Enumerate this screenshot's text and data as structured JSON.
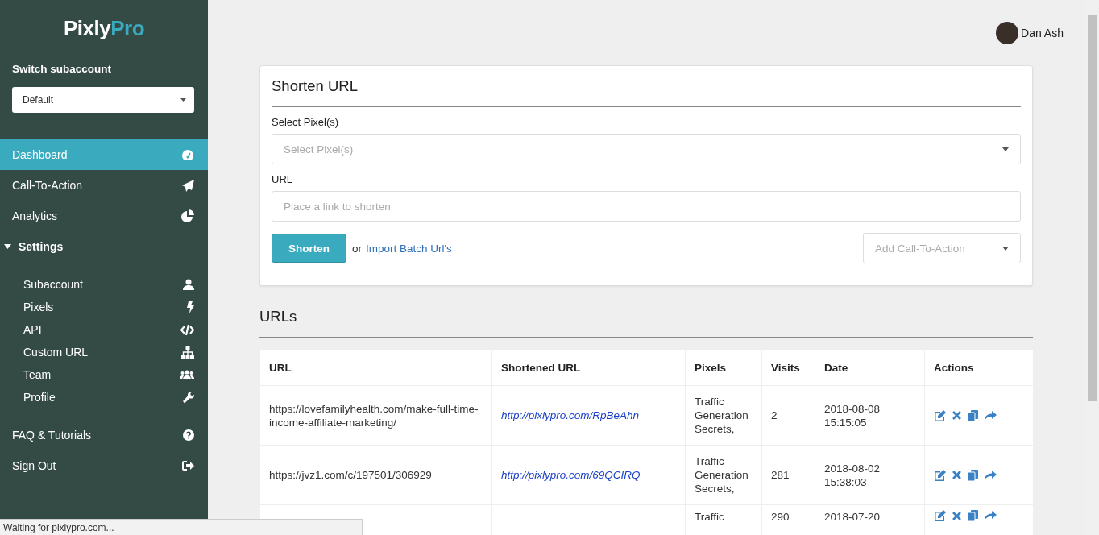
{
  "sidebar": {
    "logo": {
      "part_1": "Pixly",
      "part_2": "Pro"
    },
    "subaccount": {
      "label": "Switch subaccount",
      "value": "Default"
    },
    "items": [
      {
        "kind": "item",
        "label": "Dashboard",
        "selected": true
      },
      {
        "kind": "item",
        "label": "Call-To-Action",
        "selected": false
      },
      {
        "kind": "item",
        "label": "Analytics",
        "selected": false
      },
      {
        "kind": "group",
        "label": "Settings",
        "expanded": true,
        "children": [
          {
            "label": "Subaccount",
            "selected": false
          },
          {
            "label": "Pixels",
            "selected": false
          },
          {
            "label": "API",
            "selected": false
          },
          {
            "label": "Custom URL",
            "selected": false
          },
          {
            "label": "Team",
            "selected": false
          },
          {
            "label": "Profile",
            "selected": false
          }
        ]
      },
      {
        "kind": "item",
        "label": "FAQ & Tutorials",
        "selected": false
      },
      {
        "kind": "item",
        "label": "Sign Out",
        "selected": false
      }
    ]
  },
  "user": {
    "name": "Dan Ash"
  },
  "shorten_card": {
    "title": "Shorten URL",
    "pixels_field": {
      "label": "Select Pixel(s)",
      "placeholder": "Select Pixel(s)"
    },
    "url_field": {
      "label": "URL",
      "placeholder": "Place a link to shorten"
    },
    "shorten_button": "Shorten",
    "or_text": "or",
    "import_link": "Import Batch Url's",
    "cta_select": {
      "placeholder": "Add Call-To-Action"
    }
  },
  "urls": {
    "title": "URLs",
    "table": {
      "columns": [
        "URL",
        "Shortened URL",
        "Pixels",
        "Visits",
        "Date",
        "Actions"
      ],
      "rows": [
        {
          "url": "https://lovefamilyhealth.com/make-full-time-income-affiliate-marketing/",
          "short": "http://pixlypro.com/RpBeAhn",
          "pixels": "Traffic Generation Secrets,",
          "visits": "2",
          "date": "2018-08-08 15:15:05"
        },
        {
          "url": "https://jvz1.com/c/197501/306929",
          "short": "http://pixlypro.com/69QCIRQ",
          "pixels": "Traffic Generation Secrets,",
          "visits": "281",
          "date": "2018-08-02 15:38:03"
        },
        {
          "pixels": "Traffic",
          "visits": "290",
          "date": "2018-07-20"
        }
      ]
    }
  },
  "status_bar": "Waiting for pixlypro.com..."
}
